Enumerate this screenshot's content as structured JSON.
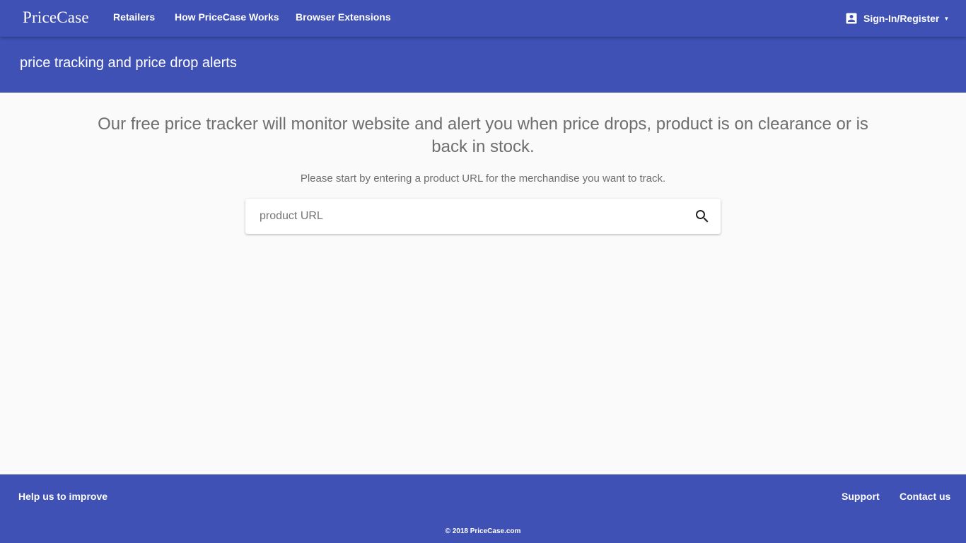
{
  "header": {
    "logo": "PriceCase",
    "nav": [
      "Retailers",
      "How PriceCase Works",
      "Browser Extensions"
    ],
    "account": {
      "label": "Sign-In/Register",
      "icon": "account-box-icon"
    }
  },
  "subheader": {
    "tagline": "price tracking and price drop alerts"
  },
  "main": {
    "headline": "Our free price tracker will monitor website and alert you when price drops, product is on clearance or is back in stock.",
    "instruction": "Please start by entering a product URL for the merchandise you want to track.",
    "search": {
      "placeholder": "product URL",
      "value": "",
      "icon": "search-icon"
    }
  },
  "footer": {
    "help": "Help us to improve",
    "support": "Support",
    "contact": "Contact us",
    "copyright": "© 2018 PriceCase.com"
  },
  "colors": {
    "primary": "#3f51b5",
    "background": "#fafafa",
    "text_muted": "#6e6e6e"
  }
}
